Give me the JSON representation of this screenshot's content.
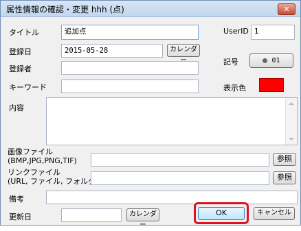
{
  "window": {
    "title": "属性情報の確認・変更 hhh (点)",
    "close_label": "✕"
  },
  "fields": {
    "title_label": "タイトル",
    "title_value": "追加点",
    "userid_label": "UserID",
    "userid_value": "1",
    "regdate_label": "登録日",
    "regdate_value": "2015-05-28",
    "calendar_label": "カレンダー",
    "registrant_label": "登録者",
    "registrant_value": "",
    "symbol_label": "記号",
    "symbol_value": "01",
    "keyword_label": "キーワード",
    "keyword_value": "",
    "color_label": "表示色",
    "color_value": "#ff0000",
    "content_label": "内容",
    "content_value": "",
    "image_label_1": "画像ファイル",
    "image_label_2": "(BMP,JPG,PNG,TIF)",
    "image_value": "",
    "browse_label": "参照",
    "link_label_1": "リンクファイル",
    "link_label_2": "(URL, ファイル, フォルダ)",
    "link_value": "",
    "remarks_label": "備考",
    "remarks_value": "",
    "update_label": "更新日",
    "update_value": "",
    "update_calendar_label": "カレンダー"
  },
  "footer": {
    "ok_label": "OK",
    "cancel_label": "キャンセル"
  }
}
